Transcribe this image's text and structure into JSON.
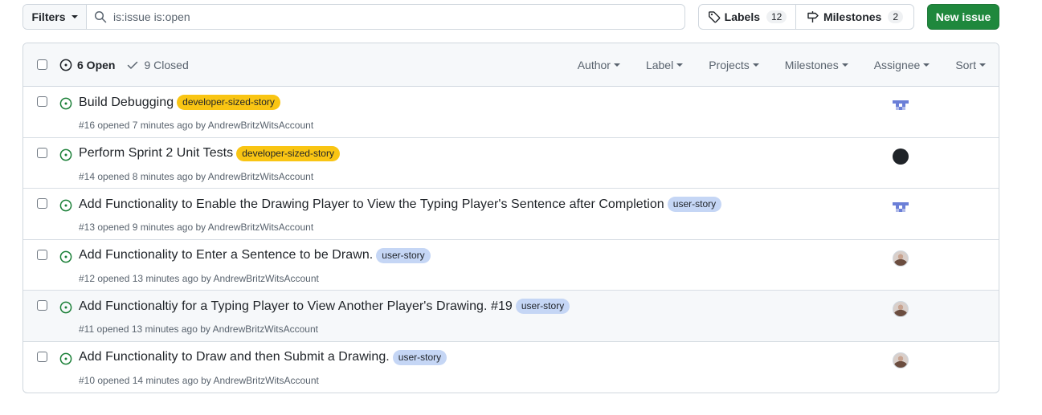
{
  "filters": {
    "button_label": "Filters",
    "search_value": "is:issue is:open"
  },
  "labels_button": {
    "label": "Labels",
    "count": "12"
  },
  "milestones_button": {
    "label": "Milestones",
    "count": "2"
  },
  "new_issue_label": "New issue",
  "header": {
    "open_label": "6 Open",
    "closed_label": "9 Closed",
    "filters": [
      "Author",
      "Label",
      "Projects",
      "Milestones",
      "Assignee",
      "Sort"
    ]
  },
  "colors": {
    "open_green": "#1a7f37",
    "developer_label": "#f9c513",
    "user_story_label": "#c5d6f5",
    "new_issue_button": "#1f883d"
  },
  "issues": [
    {
      "title": "Build Debugging",
      "label": "developer-sized-story",
      "meta": "#16 opened 7 minutes ago by AndrewBritzWitsAccount",
      "assignee_icon": "identicon"
    },
    {
      "title": "Perform Sprint 2 Unit Tests",
      "label": "developer-sized-story",
      "meta": "#14 opened 8 minutes ago by AndrewBritzWitsAccount",
      "assignee_icon": "black-avatar"
    },
    {
      "title": "Add Functionality to Enable the Drawing Player to View the Typing Player's Sentence after Completion",
      "label": "user-story",
      "meta": "#13 opened 9 minutes ago by AndrewBritzWitsAccount",
      "assignee_icon": "identicon"
    },
    {
      "title": "Add Functionality to Enter a Sentence to be Drawn.",
      "label": "user-story",
      "meta": "#12 opened 13 minutes ago by AndrewBritzWitsAccount",
      "assignee_icon": "photo-avatar"
    },
    {
      "title": "Add Functionaltiy for a Typing Player to View Another Player's Drawing. #19",
      "label": "user-story",
      "meta": "#11 opened 13 minutes ago by AndrewBritzWitsAccount",
      "assignee_icon": "photo-avatar"
    },
    {
      "title": "Add Functionality to Draw and then Submit a Drawing.",
      "label": "user-story",
      "meta": "#10 opened 14 minutes ago by AndrewBritzWitsAccount",
      "assignee_icon": "photo-avatar"
    }
  ]
}
